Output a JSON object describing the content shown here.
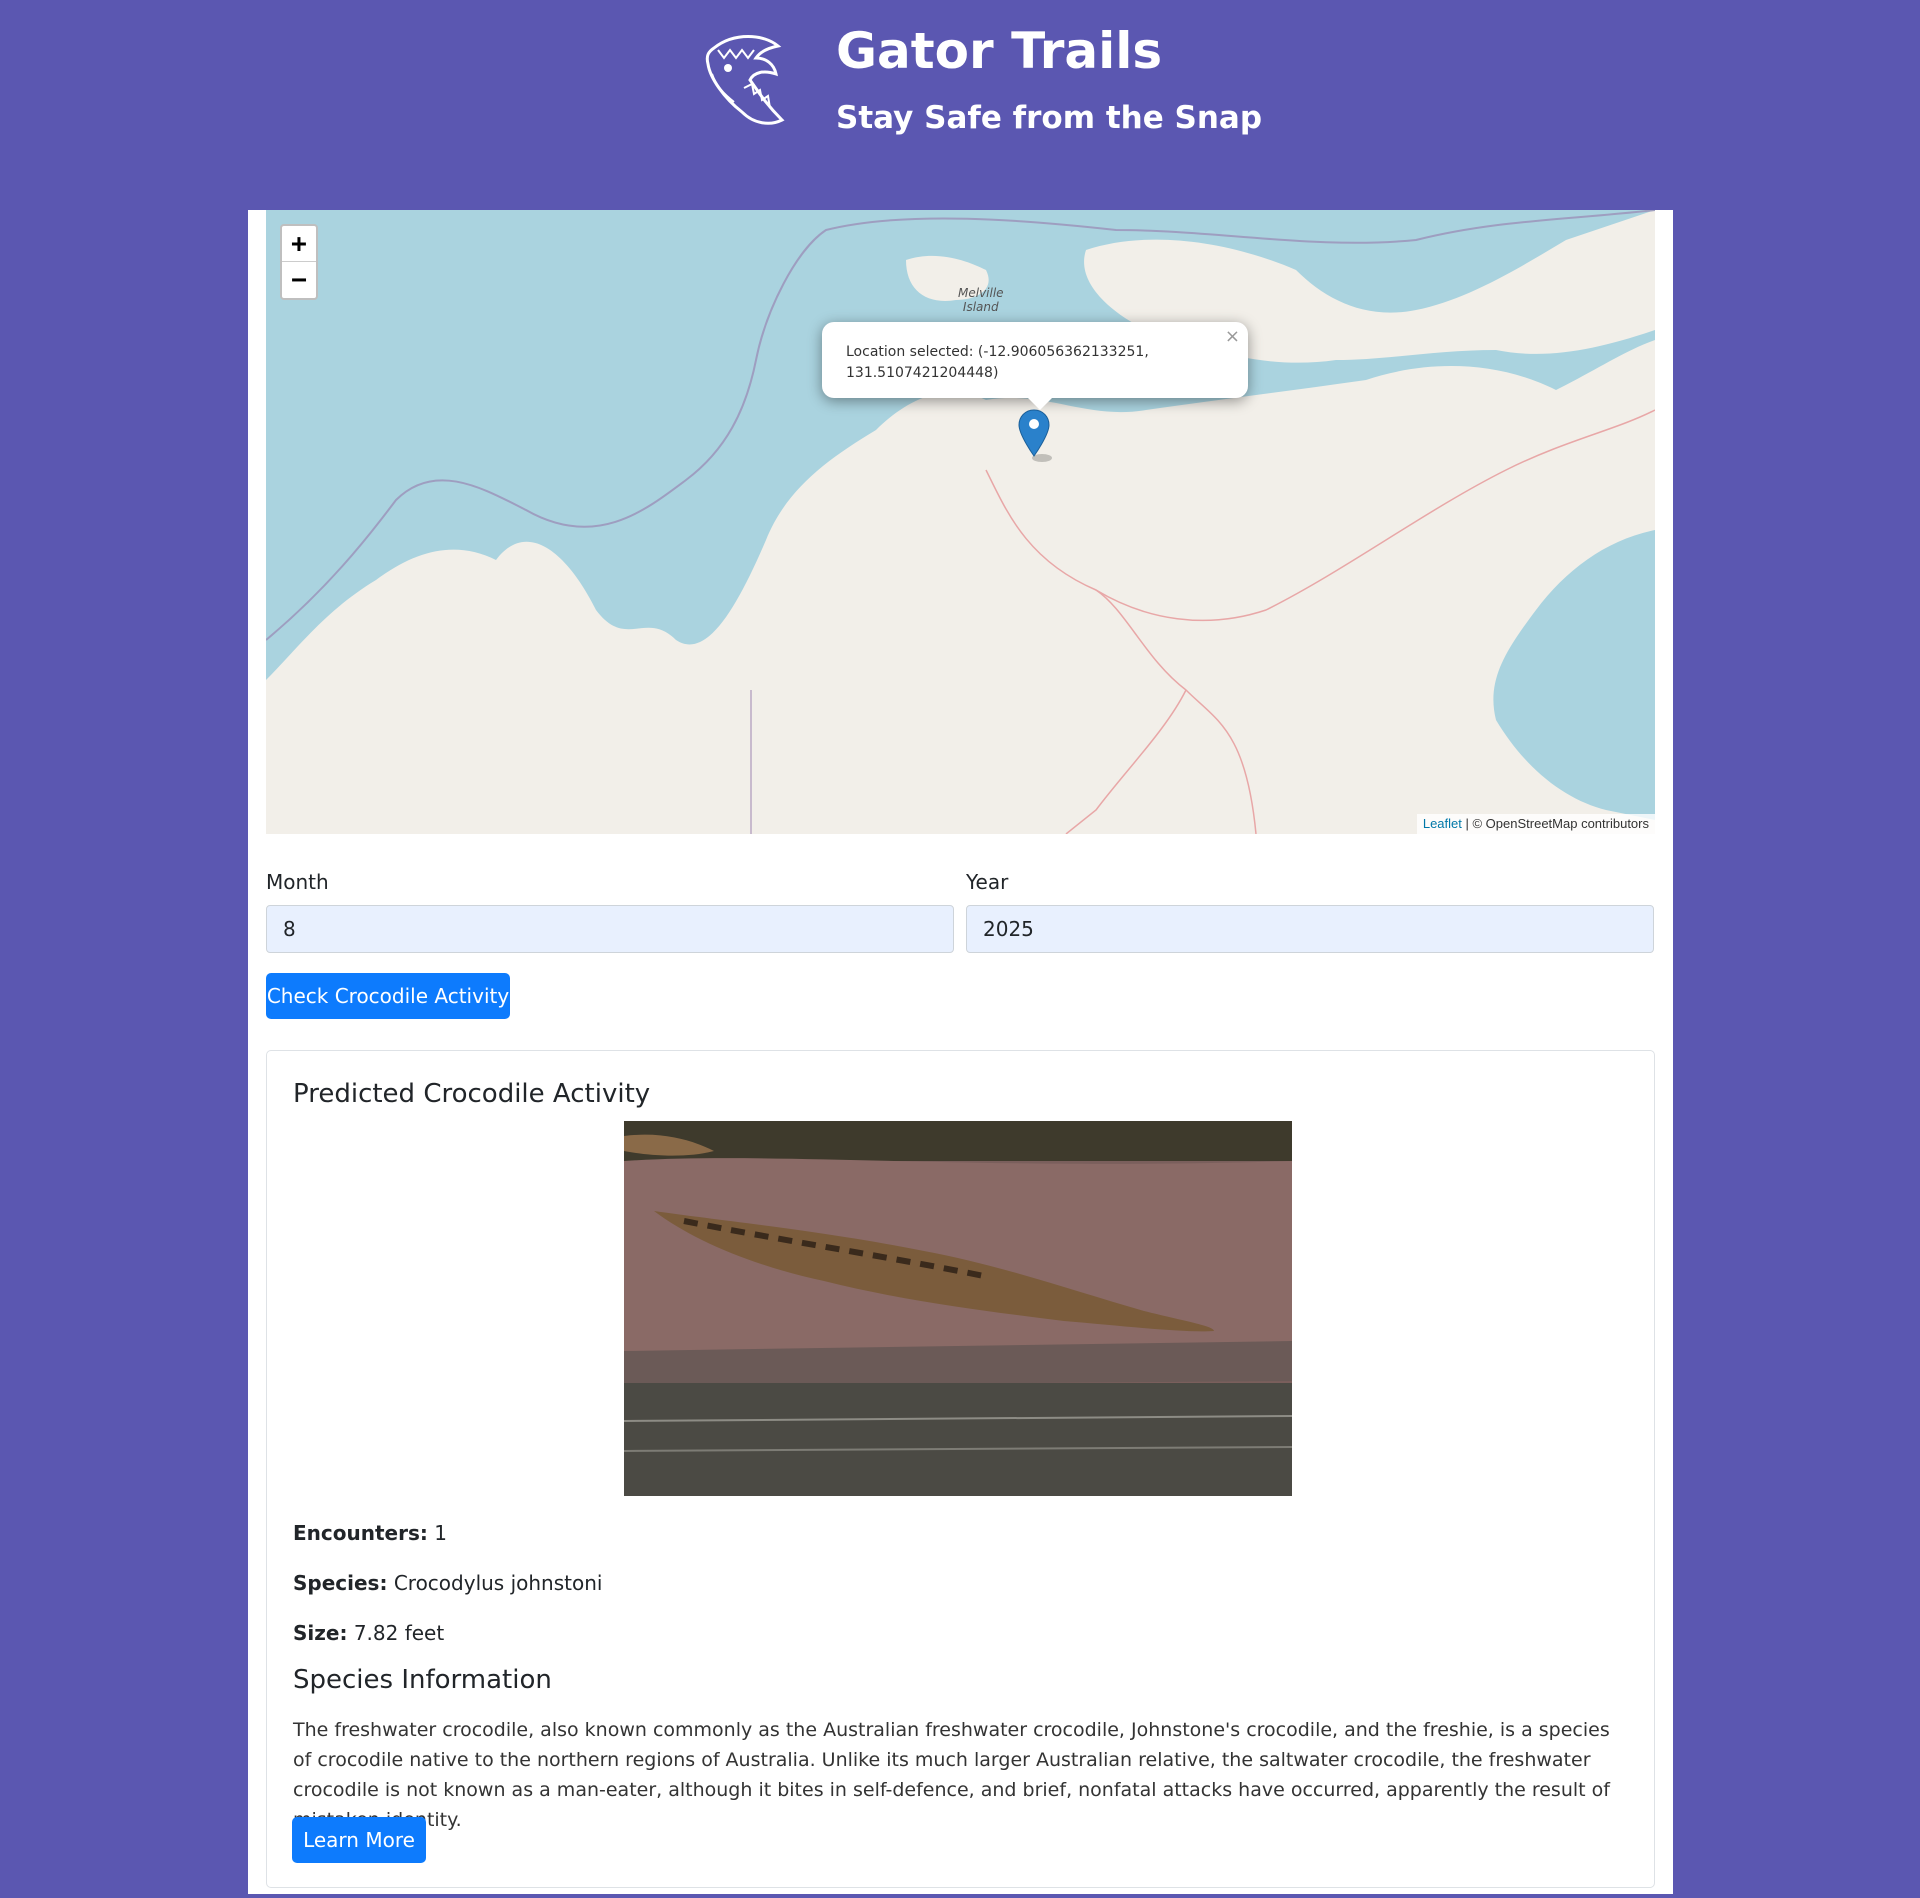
{
  "header": {
    "title": "Gator Trails",
    "subtitle": "Stay Safe from the Snap"
  },
  "map": {
    "zoom_in": "+",
    "zoom_out": "−",
    "place_label_line1": "Melville",
    "place_label_line2": "Island",
    "popup_text": "Location selected: (-12.906056362133251, 131.5107421204448)",
    "popup_close": "×",
    "attribution_link": "Leaflet",
    "attribution_text": " | © OpenStreetMap contributors"
  },
  "form": {
    "month_label": "Month",
    "month_value": "8",
    "year_label": "Year",
    "year_value": "2025",
    "submit_label": "Check Crocodile Activity"
  },
  "result": {
    "title": "Predicted Crocodile Activity",
    "encounters_label": "Encounters:",
    "encounters_value": " 1",
    "species_label": "Species:",
    "species_value": " Crocodylus johnstoni",
    "size_label": "Size:",
    "size_value": " 7.82 feet",
    "info_title": "Species Information",
    "info_text": "The freshwater crocodile, also known commonly as the Australian freshwater crocodile, Johnstone's crocodile, and the freshie, is a species of crocodile native to the northern regions of Australia. Unlike its much larger Australian relative, the saltwater crocodile, the freshwater crocodile is not known as a man-eater, although it bites in self-defence, and brief, nonfatal attacks have occurred, apparently the result of mistaken identity.",
    "learn_more_label": "Learn More"
  },
  "colors": {
    "page_background": "#5b57b1",
    "primary_button": "#0d7bfd",
    "map_water": "#aad3df",
    "map_land": "#f2efe9",
    "marker": "#2a81cb"
  }
}
